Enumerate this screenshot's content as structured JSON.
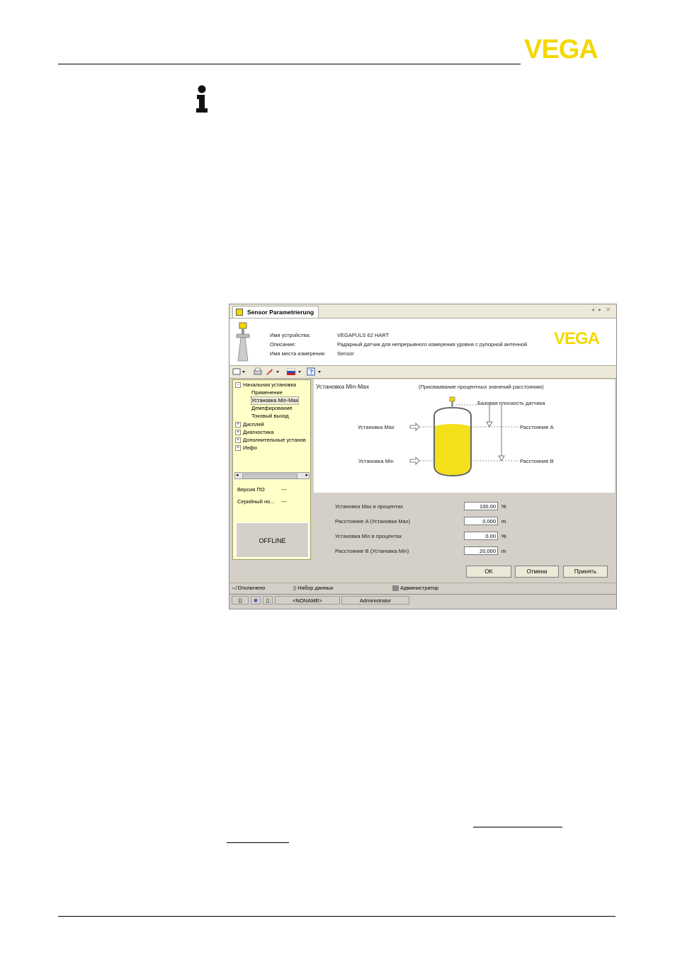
{
  "page": {
    "logo_text": "VEGA",
    "info_icon": "info-icon"
  },
  "window": {
    "tab_title": "Sensor Parametrierung",
    "tab_nav": "◂ ▸ ✕",
    "header": {
      "device_name_label": "Имя устройства:",
      "device_name_value": "VEGAPULS 62 HART",
      "description_label": "Описание:",
      "description_value": "Радарный датчик для непрерывного измерения уровня с рупорной антенной",
      "measurement_point_label": "Имя места измерения",
      "measurement_point_value": "Sensor",
      "logo_text": "VEGA"
    },
    "toolbar": {
      "icons": [
        "view-icon",
        "print-icon",
        "wrench-icon",
        "flag-icon",
        "help-icon"
      ]
    },
    "tree": {
      "items": [
        {
          "label": "Начальная установка",
          "sign": "−",
          "level": 0
        },
        {
          "label": "Применение",
          "level": 1
        },
        {
          "label": "Установка Min-Max",
          "level": 1,
          "selected": true
        },
        {
          "label": "Демпфирование",
          "level": 1
        },
        {
          "label": "Токовый выход",
          "level": 1
        },
        {
          "label": "Дисплей",
          "sign": "+",
          "level": 0
        },
        {
          "label": "Диагностика",
          "sign": "+",
          "level": 0
        },
        {
          "label": "Дополнительные установ",
          "sign": "+",
          "level": 0
        },
        {
          "label": "Инфо",
          "sign": "+",
          "level": 0
        }
      ]
    },
    "info_panel": {
      "sw_version_label": "Версия ПО",
      "sw_version_value": "---",
      "serial_label": "Серийный но...",
      "serial_value": "---",
      "offline_text": "OFFLINE"
    },
    "minmax": {
      "title": "Установка Min-Max",
      "subtitle": "(Присваивание процентных значений расстоянию)",
      "reference_plane": "Базовая плоскость датчика",
      "max_adj_label": "Установка Max",
      "min_adj_label": "Установка Min",
      "distance_a": "Расстояние A",
      "distance_b": "Расстояние B",
      "fields": [
        {
          "label": "Установка Max в процентах",
          "value": "100.00",
          "unit": "%"
        },
        {
          "label": "Расстояние A (Установка Max)",
          "value": "0,000",
          "unit": "m"
        },
        {
          "label": "Установка Min в процентах",
          "value": "0.00",
          "unit": "%"
        },
        {
          "label": "Расстояние B (Установка Min)",
          "value": "20,000",
          "unit": "m"
        }
      ]
    },
    "buttons": {
      "ok": "OK",
      "cancel": "Отмена",
      "apply": "Принять"
    },
    "statusbar": {
      "disconnected": "Отключено",
      "dataset": "Набор данных",
      "admin_ru": "Администратор",
      "noname": "<NONAME>",
      "admin_en": "Administrator"
    }
  },
  "colors": {
    "vega_yellow": "#f4d800",
    "panel_yellow": "#ffffc8",
    "tank_fill": "#f4e01a"
  }
}
